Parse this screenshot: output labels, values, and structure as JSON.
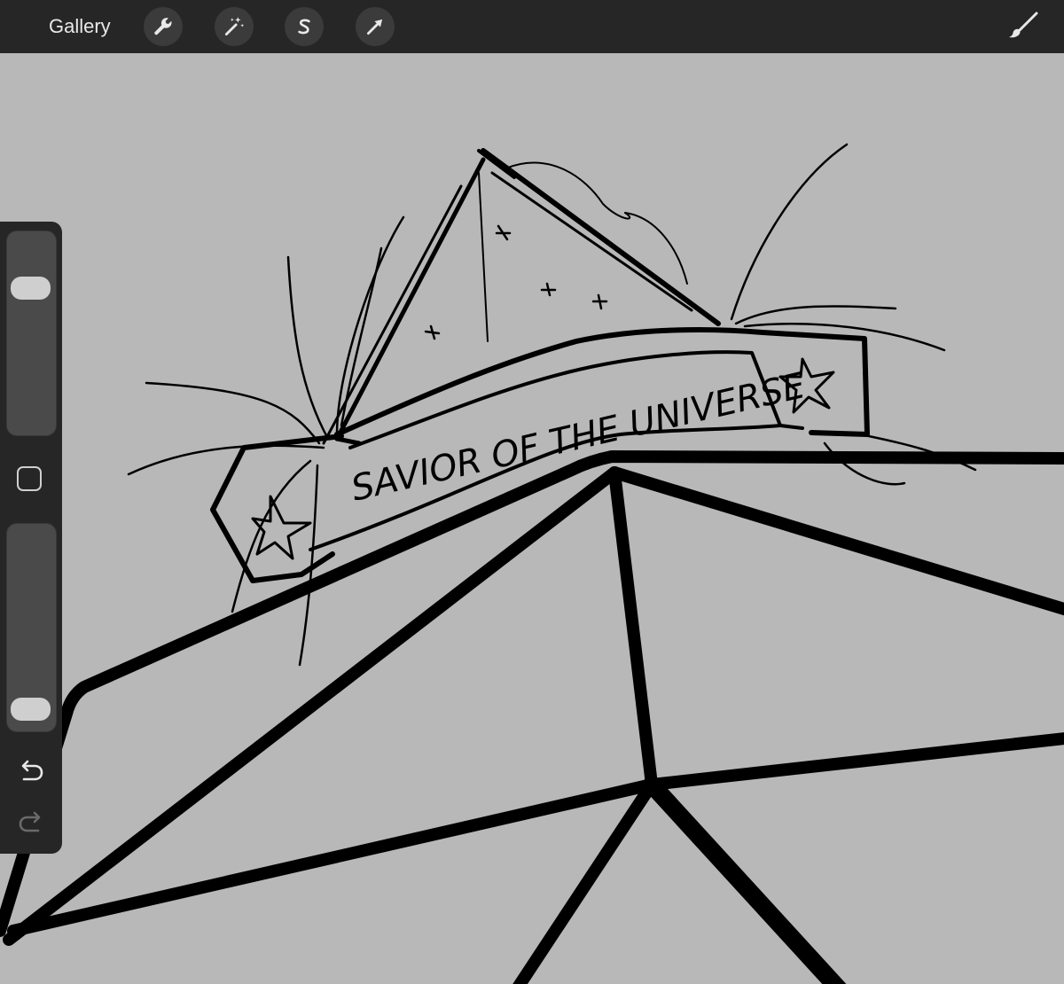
{
  "topbar": {
    "gallery_label": "Gallery",
    "tools": [
      {
        "name": "actions",
        "icon": "wrench-icon"
      },
      {
        "name": "adjustments",
        "icon": "magic-wand-icon"
      },
      {
        "name": "selection",
        "icon": "selection-s-icon"
      },
      {
        "name": "transform",
        "icon": "arrow-cursor-icon"
      }
    ],
    "brush_icon": "brush-icon"
  },
  "sidebar": {
    "brush_size_level": 0.76,
    "opacity_level": 0.04,
    "modify_icon": "square-icon",
    "undo_icon": "undo-icon",
    "redo_icon": "redo-icon"
  },
  "canvas": {
    "background": "#b8b8b8",
    "banner_text": "SAVIOR OF THE UNIVERSE"
  },
  "colors": {
    "toolbar": "#262626",
    "button": "#3b3b3b",
    "icon": "#e8e8e8",
    "ink": "#000000"
  }
}
